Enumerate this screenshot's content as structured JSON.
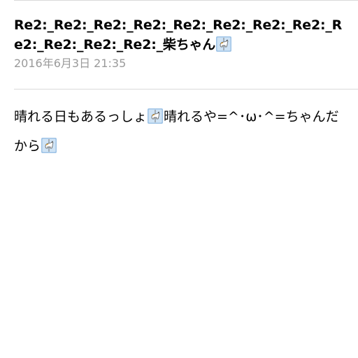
{
  "message": {
    "subject": "Re2:_Re2:_Re2:_Re2:_Re2:_Re2:_Re2:_Re2:_Re2:_Re2:_Re2:_Re2:_柴ちゃん",
    "date": "2016年6月3日 21:35",
    "body": {
      "part1": "晴れる日もあるっしょ",
      "part2": "晴れるや=^･ω･^=ちゃんだから"
    }
  },
  "icons": {
    "subject_emoji": "carousel-horse-emoji-icon",
    "body_emoji_1": "carousel-horse-emoji-icon",
    "body_emoji_2": "carousel-horse-emoji-icon"
  }
}
